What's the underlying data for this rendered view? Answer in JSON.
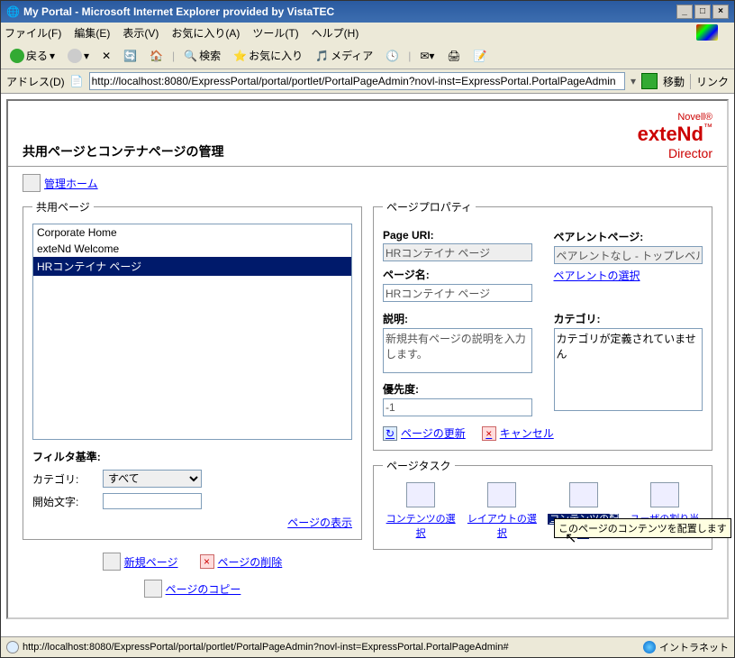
{
  "window": {
    "title": "My Portal - Microsoft Internet Explorer provided by VistaTEC"
  },
  "menu": {
    "file": "ファイル(F)",
    "edit": "編集(E)",
    "view": "表示(V)",
    "favorites": "お気に入り(A)",
    "tools": "ツール(T)",
    "help": "ヘルプ(H)"
  },
  "toolbar": {
    "back": "戻る",
    "search": "検索",
    "favorites": "お気に入り",
    "media": "メディア"
  },
  "addrbar": {
    "label": "アドレス(D)",
    "url": "http://localhost:8080/ExpressPortal/portal/portlet/PortalPageAdmin?novl-inst=ExpressPortal.PortalPageAdmin",
    "go": "移動",
    "links": "リンク"
  },
  "brand": {
    "novell": "Novell®",
    "extend": "exteNd",
    "tm": "™",
    "director": "Director"
  },
  "page": {
    "title": "共用ページとコンテナページの管理",
    "adminhome": "管理ホーム"
  },
  "sharedpages": {
    "legend": "共用ページ",
    "items": [
      "Corporate Home",
      "exteNd Welcome",
      "HRコンテイナ ページ"
    ],
    "selectedIndex": 2,
    "filter_label": "フィルタ基準:",
    "category_label": "カテゴリ:",
    "category_value": "すべて",
    "start_label": "開始文字:",
    "start_value": "",
    "showpages": "ページの表示"
  },
  "pageprops": {
    "legend": "ページプロパティ",
    "uri_label": "Page URI:",
    "uri_value": "HRコンテイナ ページ",
    "parent_label": "ペアレントページ:",
    "parent_value": "ペアレントなし - トップレベル",
    "parent_select": "ペアレントの選択",
    "name_label": "ページ名:",
    "name_value": "HRコンテイナ ページ",
    "desc_label": "説明:",
    "desc_value": "新規共有ページの説明を入力します。",
    "cat_label": "カテゴリ:",
    "cat_value": "カテゴリが定義されていません",
    "priority_label": "優先度:",
    "priority_value": "-1",
    "update": "ページの更新",
    "cancel": "キャンセル"
  },
  "tasks": {
    "legend": "ページタスク",
    "content": "コンテンツの選択",
    "layout": "レイアウトの選択",
    "arrange": "コンテンツの配置",
    "assign": "ユーザの割り当て",
    "tooltip": "このページのコンテンツを配置します"
  },
  "bottom": {
    "newpage": "新規ページ",
    "deletepage": "ページの削除",
    "copypage": "ページのコピー"
  },
  "status": {
    "url": "http://localhost:8080/ExpressPortal/portal/portlet/PortalPageAdmin?novl-inst=ExpressPortal.PortalPageAdmin#",
    "zone": "イントラネット"
  }
}
